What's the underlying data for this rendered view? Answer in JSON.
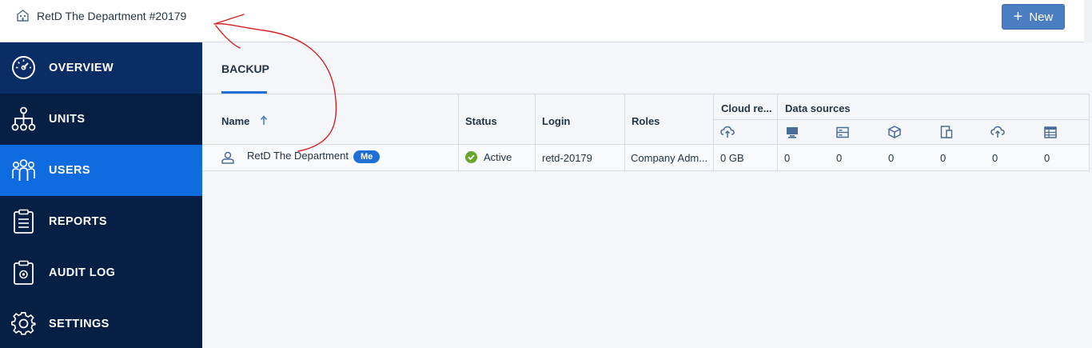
{
  "topbar": {
    "tenant_name": "RetD The Department #20179",
    "tenant_icon": "building-icon",
    "new_button_label": "New"
  },
  "sidebar": {
    "items": [
      {
        "label": "OVERVIEW",
        "icon": "dashboard-gauge-icon"
      },
      {
        "label": "UNITS",
        "icon": "hierarchy-icon"
      },
      {
        "label": "USERS",
        "icon": "users-group-icon",
        "selected": true
      },
      {
        "label": "REPORTS",
        "icon": "clipboard-icon"
      },
      {
        "label": "AUDIT LOG",
        "icon": "audit-clipboard-gear-icon"
      },
      {
        "label": "SETTINGS",
        "icon": "gear-icon"
      }
    ],
    "colors": {
      "background": "#051f45",
      "hover": "#0a2d66",
      "selected": "#0f6be0"
    }
  },
  "main": {
    "tab": "BACKUP",
    "table": {
      "headers": {
        "name": "Name",
        "status": "Status",
        "login": "Login",
        "roles": "Roles",
        "cloud": "Cloud re...",
        "data_sources": "Data sources"
      },
      "sort_indicator": "arrow-up-icon",
      "data_source_icons": [
        "cloud-upload-icon",
        "desktop-icon",
        "server-icon",
        "cube-icon",
        "mobile-device-icon",
        "cloud-upload-icon",
        "database-table-icon"
      ],
      "rows": [
        {
          "name": "RetD The Department",
          "badge": "Me",
          "status": "Active",
          "login": "retd-20179",
          "roles": "Company Adm...",
          "cloud": "0 GB",
          "sources": [
            "0",
            "0",
            "0",
            "0",
            "0",
            "0"
          ]
        }
      ]
    }
  },
  "colors": {
    "accent": "#1f6fd6",
    "active_status": "#6aa52b",
    "annotation": "#d41f1f"
  }
}
